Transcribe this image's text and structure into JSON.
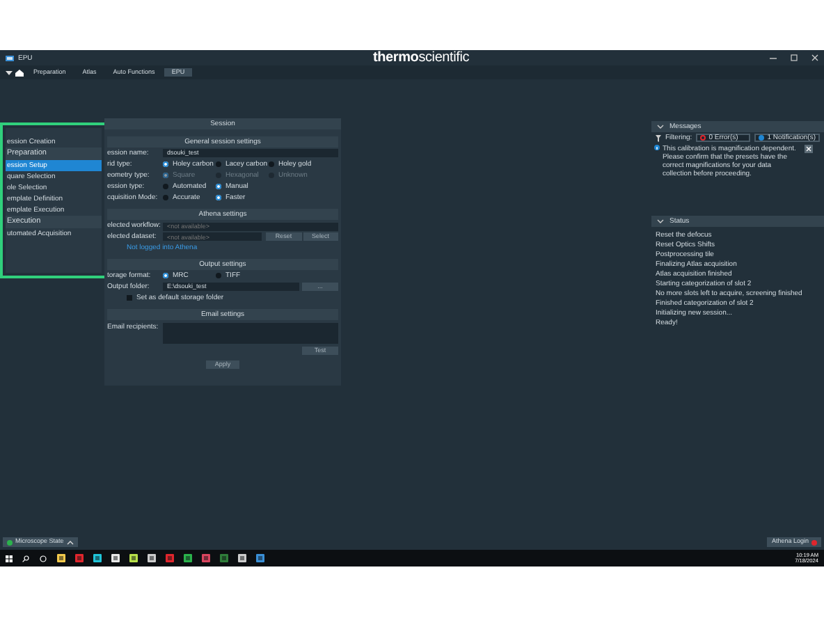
{
  "window": {
    "title": "EPU",
    "logo": "**thermo**scientific",
    "tabs": [
      {
        "label": "Preparation",
        "selected": false
      },
      {
        "label": "Atlas",
        "selected": false
      },
      {
        "label": "Auto Functions",
        "selected": false
      },
      {
        "label": "EPU",
        "selected": true
      }
    ]
  },
  "sidebar": {
    "items": [
      {
        "label": "ession Creation",
        "kind": "item",
        "selected": false
      },
      {
        "label": "Preparation",
        "kind": "header",
        "selected": false
      },
      {
        "label": "ession Setup",
        "kind": "item",
        "selected": true
      },
      {
        "label": "quare Selection",
        "kind": "item",
        "selected": false
      },
      {
        "label": "ole Selection",
        "kind": "item",
        "selected": false
      },
      {
        "label": "emplate Definition",
        "kind": "item",
        "selected": false
      },
      {
        "label": "emplate Execution",
        "kind": "item",
        "selected": false
      },
      {
        "label": "Execution",
        "kind": "header",
        "selected": false
      },
      {
        "label": "utomated Acquisition",
        "kind": "item",
        "selected": false
      }
    ]
  },
  "session": {
    "title": "Session",
    "general": {
      "title": "General session settings",
      "name_label": "ession name:",
      "name_value": "dsouki_test",
      "radio_rows": [
        {
          "label": "rid type:",
          "disabled": false,
          "options": [
            {
              "label": "Holey carbon",
              "selected": true
            },
            {
              "label": "Lacey carbon",
              "selected": false
            },
            {
              "label": "Holey gold",
              "selected": false
            }
          ]
        },
        {
          "label": "eometry type:",
          "disabled": true,
          "options": [
            {
              "label": "Square",
              "selected": true
            },
            {
              "label": "Hexagonal",
              "selected": false
            },
            {
              "label": "Unknown",
              "selected": false
            }
          ]
        },
        {
          "label": "ession type:",
          "disabled": false,
          "options": [
            {
              "label": "Automated",
              "selected": false
            },
            {
              "label": "Manual",
              "selected": true
            }
          ]
        },
        {
          "label": "cquisition Mode:",
          "disabled": false,
          "options": [
            {
              "label": "Accurate",
              "selected": false
            },
            {
              "label": "Faster",
              "selected": true
            }
          ]
        }
      ]
    },
    "athena": {
      "title": "Athena settings",
      "workflow_label": "elected workflow:",
      "workflow_placeholder": "<not available>",
      "dataset_label": "elected dataset:",
      "dataset_placeholder": "<not available>",
      "buttons": [
        "Reset",
        "Select"
      ],
      "link": "Not logged into Athena"
    },
    "output": {
      "title": "Output settings",
      "format_label": "torage format:",
      "formats": [
        {
          "label": "MRC",
          "selected": true
        },
        {
          "label": "TIFF",
          "selected": false
        }
      ],
      "folder_label": "Output folder:",
      "folder_value": "E:\\dsouki_test",
      "browse_button": "...",
      "default_label": "Set as default storage folder",
      "default_checked": false
    },
    "email": {
      "title": "Email settings",
      "recipients_label": "Email recipients:",
      "test_button": "Test"
    },
    "apply_button": "Apply"
  },
  "messages": {
    "title": "Messages",
    "filter_label": "Filtering:",
    "errors": "0 Error(s)",
    "notifications": "1 Notification(s)",
    "items": [
      {
        "text": "This calibration is magnification dependent. Please confirm that the presets have the correct magnifications for your data collection before proceeding."
      }
    ]
  },
  "status": {
    "title": "Status",
    "lines": [
      "Reset the defocus",
      "Reset Optics Shifts",
      "Postprocessing tile",
      "Finalizing Atlas acquisition",
      "Atlas acquisition finished",
      "Starting categorization of slot 2",
      "No more slots left to acquire, screening finished",
      "Finished categorization of slot 2",
      "Initializing new session...",
      "Ready!"
    ]
  },
  "status_bar": {
    "microscope_state": "Microscope State",
    "athena_login": "Athena Login"
  },
  "taskbar": {
    "time": "10:19 AM",
    "date": "7/18/2024"
  }
}
